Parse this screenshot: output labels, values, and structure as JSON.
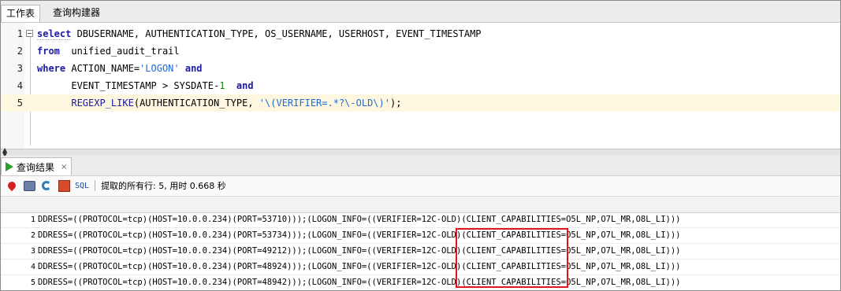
{
  "tabs": {
    "worksheet": "工作表",
    "query_builder": "查询构建器"
  },
  "editor": {
    "line_numbers": [
      "1",
      "2",
      "3",
      "4",
      "5"
    ],
    "lines": [
      {
        "kw": "select",
        "rest": " DBUSERNAME, AUTHENTICATION_TYPE, OS_USERNAME, USERHOST, EVENT_TIMESTAMP"
      },
      {
        "kw": "from",
        "rest": "  unified_audit_trail"
      },
      {
        "kw": "where",
        "rest": " ACTION_NAME=",
        "str": "'LOGON'",
        "kw2": " and"
      },
      {
        "indent": "      ",
        "rest": "EVENT_TIMESTAMP > SYSDATE-",
        "num": "1",
        "kw2": "  and"
      },
      {
        "indent": "      ",
        "fn": "REGEXP_LIKE",
        "rest": "(AUTHENTICATION_TYPE, ",
        "str": "'\\(VERIFIER=.*?\\-OLD\\)'",
        "tail": ");"
      }
    ]
  },
  "results": {
    "tab_label": "查询结果",
    "close": "×",
    "sql_label": "SQL",
    "status": "提取的所有行: 5, 用时 0.668 秒",
    "rows": [
      {
        "num": "1",
        "text": "DDRESS=((PROTOCOL=tcp)(HOST=10.0.0.234)(PORT=53710)));(LOGON_INFO=((VERIFIER=12C-OLD)(CLIENT_CAPABILITIES=O5L_NP,O7L_MR,O8L_LI)))"
      },
      {
        "num": "2",
        "text": "DDRESS=((PROTOCOL=tcp)(HOST=10.0.0.234)(PORT=53734)));(LOGON_INFO=((VERIFIER=12C-OLD)(CLIENT_CAPABILITIES=O5L_NP,O7L_MR,O8L_LI)))"
      },
      {
        "num": "3",
        "text": "DDRESS=((PROTOCOL=tcp)(HOST=10.0.0.234)(PORT=49212)));(LOGON_INFO=((VERIFIER=12C-OLD)(CLIENT_CAPABILITIES=O5L_NP,O7L_MR,O8L_LI)))"
      },
      {
        "num": "4",
        "text": "DDRESS=((PROTOCOL=tcp)(HOST=10.0.0.234)(PORT=48924)));(LOGON_INFO=((VERIFIER=12C-OLD)(CLIENT_CAPABILITIES=O5L_NP,O7L_MR,O8L_LI)))"
      },
      {
        "num": "5",
        "text": "DDRESS=((PROTOCOL=tcp)(HOST=10.0.0.234)(PORT=48942)));(LOGON_INFO=((VERIFIER=12C-OLD)(CLIENT_CAPABILITIES=O5L_NP,O7L_MR,O8L_LI)))"
      }
    ]
  },
  "colors": {
    "keyword": "#1a1aa6",
    "string": "#1e6ad6",
    "number": "#0a8a0a",
    "current_line": "#fdf8df",
    "highlight_box": "#e0161c",
    "run_icon": "#2aa12a"
  },
  "icons": [
    "freeze-pin-icon",
    "print-icon",
    "refresh-icon",
    "export-icon",
    "run-icon",
    "fold-icon"
  ]
}
